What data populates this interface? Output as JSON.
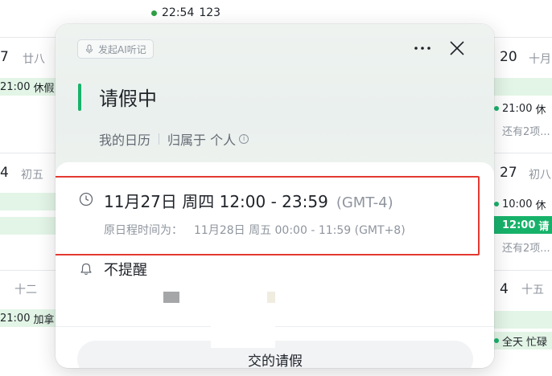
{
  "background": {
    "top_event": {
      "time": "22:54",
      "title": "123"
    },
    "left": {
      "day1": {
        "num": "7",
        "lunar": "廿八"
      },
      "ev1": {
        "time": "21:00",
        "title": "休假"
      },
      "day2": {
        "num": "4",
        "lunar": "初五"
      },
      "day3_lunar": "十二",
      "ev2": {
        "time": "21:00",
        "title": "加拿"
      }
    },
    "right": {
      "day1": {
        "num": "20",
        "lunar": "十月"
      },
      "ev1": {
        "time": "21:00",
        "title": "休"
      },
      "more1": "还有2项...",
      "day2": {
        "num": "27",
        "lunar": "初八"
      },
      "ev2": {
        "time": "10:00",
        "title": "休"
      },
      "ev3": {
        "time": "12:00",
        "title": "请"
      },
      "more2": "还有2项...",
      "day3": {
        "num": "4",
        "lunar": "十五"
      },
      "ev4": {
        "time": "全天",
        "title": "忙碌"
      }
    }
  },
  "popup": {
    "ai_button": "发起AI听记",
    "title": "请假中",
    "calendar": "我的日历",
    "owner": "归属于 个人",
    "time_main": "11月27日 周四 12:00 - 23:59",
    "timezone": "(GMT-4)",
    "orig_label": "原日程时间为：",
    "orig_value": "11月28日 周五 00:00 - 11:59 (GMT+8)",
    "reminder": "不提醒",
    "bottom_button": "交的请假"
  },
  "colors": {
    "accent_green": "#17b26a",
    "highlight_red": "#e33a32"
  }
}
